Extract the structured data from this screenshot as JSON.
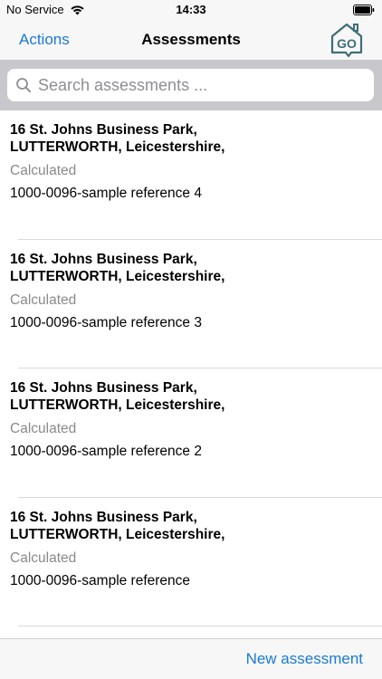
{
  "status_bar": {
    "carrier": "No Service",
    "time": "14:33",
    "wifi_icon": "wifi-icon",
    "battery_icon": "battery-icon"
  },
  "nav": {
    "actions_label": "Actions",
    "title": "Assessments",
    "logo_text": "GO",
    "logo_color": "#3d6e78"
  },
  "search": {
    "placeholder": "Search assessments ...",
    "value": ""
  },
  "assessments": [
    {
      "address_line1": "16 St. Johns Business Park,",
      "address_line2": "LUTTERWORTH, Leicestershire,",
      "status": "Calculated",
      "reference": "1000-0096-sample reference 4"
    },
    {
      "address_line1": "16 St. Johns Business Park,",
      "address_line2": "LUTTERWORTH, Leicestershire,",
      "status": "Calculated",
      "reference": "1000-0096-sample reference 3"
    },
    {
      "address_line1": "16 St. Johns Business Park,",
      "address_line2": "LUTTERWORTH, Leicestershire,",
      "status": "Calculated",
      "reference": "1000-0096-sample reference 2"
    },
    {
      "address_line1": "16 St. Johns Business Park,",
      "address_line2": "LUTTERWORTH, Leicestershire,",
      "status": "Calculated",
      "reference": "1000-0096-sample reference"
    }
  ],
  "toolbar": {
    "new_assessment_label": "New assessment"
  },
  "colors": {
    "accent": "#1a7ad6",
    "status_gray": "#8a8a8a"
  }
}
